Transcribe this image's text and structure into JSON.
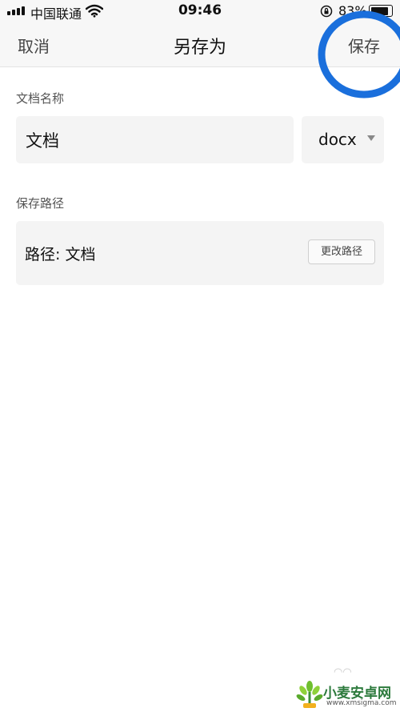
{
  "status_bar": {
    "carrier": "中国联通",
    "time": "09:46",
    "battery_text": "83%",
    "battery_level": 0.83
  },
  "nav": {
    "cancel_label": "取消",
    "title": "另存为",
    "save_label": "保存",
    "annotation_color": "#1a6fdc"
  },
  "form": {
    "name_label": "文档名称",
    "name_value": "文档",
    "extension_value": "docx",
    "path_section_label": "保存路径",
    "path_text": "路径: 文档",
    "change_path_label": "更改路径"
  },
  "watermark": {
    "name": "小麦安卓网",
    "url": "www.xmsigma.com"
  }
}
